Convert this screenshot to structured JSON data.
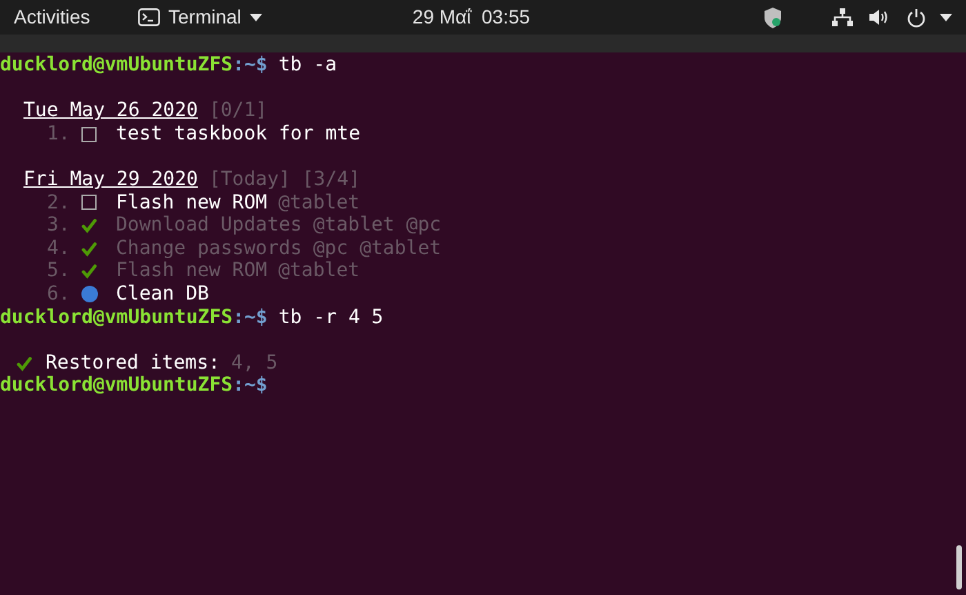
{
  "top_bar": {
    "activities": "Activities",
    "app_menu": "Terminal",
    "clock": "29 Μαΐ  03:55"
  },
  "terminal": {
    "lines": [
      {
        "kind": "prompt",
        "user": "ducklord@vmUbuntuZFS",
        "path": ":~$",
        "command": "tb -a"
      },
      {
        "kind": "blank"
      },
      {
        "kind": "date",
        "date": "Tue May 26 2020",
        "extra": "[0/1]"
      },
      {
        "kind": "task",
        "number": "1.",
        "done": false,
        "started": false,
        "text": "test taskbook for mte"
      },
      {
        "kind": "blank"
      },
      {
        "kind": "date",
        "date": "Fri May 29 2020",
        "extra": "[Today] [3/4]"
      },
      {
        "kind": "task",
        "number": "2.",
        "done": false,
        "started": false,
        "text": "Flash new ROM",
        "tags": "@tablet"
      },
      {
        "kind": "task",
        "number": "3.",
        "done": true,
        "started": false,
        "text": "Download Updates",
        "tags": "@tablet @pc"
      },
      {
        "kind": "task",
        "number": "4.",
        "done": true,
        "started": false,
        "text": "Change passwords",
        "tags": "@pc @tablet"
      },
      {
        "kind": "task",
        "number": "5.",
        "done": true,
        "started": false,
        "text": "Flash new ROM",
        "tags": "@tablet"
      },
      {
        "kind": "task",
        "number": "6.",
        "done": false,
        "started": true,
        "text": "Clean DB"
      },
      {
        "kind": "prompt",
        "user": "ducklord@vmUbuntuZFS",
        "path": ":~$",
        "command": "tb -r 4 5"
      },
      {
        "kind": "blank"
      },
      {
        "kind": "message",
        "label": "Restored items:",
        "value": "4, 5"
      },
      {
        "kind": "prompt",
        "user": "ducklord@vmUbuntuZFS",
        "path": ":~$"
      }
    ]
  }
}
